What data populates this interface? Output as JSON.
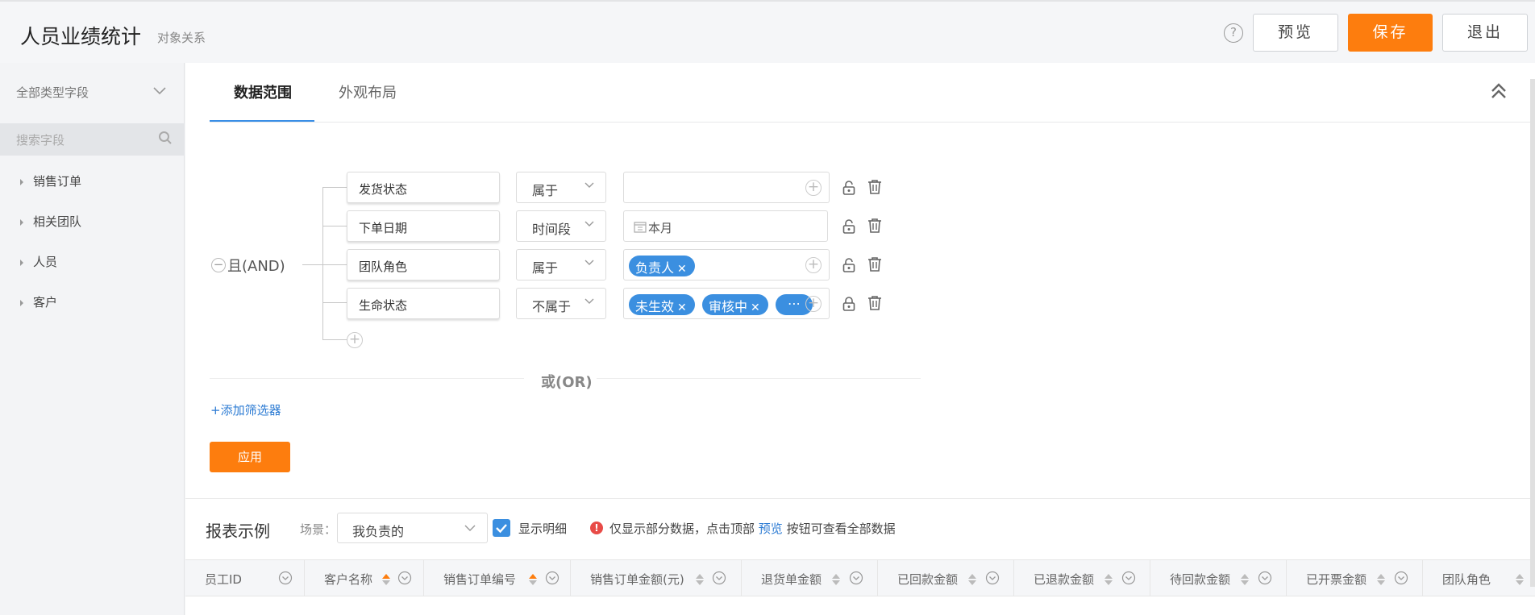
{
  "header": {
    "title": "人员业绩统计",
    "subtitle": "对象关系",
    "help": "?",
    "preview_label": "预览",
    "save_label": "保存",
    "exit_label": "退出"
  },
  "sidebar": {
    "type_filter": "全部类型字段",
    "search_placeholder": "搜索字段",
    "items": [
      {
        "label": "销售订单"
      },
      {
        "label": "相关团队"
      },
      {
        "label": "人员"
      },
      {
        "label": "客户"
      }
    ]
  },
  "tabs": [
    {
      "label": "数据范围",
      "active": true
    },
    {
      "label": "外观布局",
      "active": false
    }
  ],
  "filter": {
    "group_label": "且(AND)",
    "rows": [
      {
        "field": "发货状态",
        "operator": "属于",
        "value": ""
      },
      {
        "field": "下单日期",
        "operator": "时间段",
        "value": "本月"
      },
      {
        "field": "团队角色",
        "operator": "属于",
        "tags": [
          "负责人"
        ]
      },
      {
        "field": "生命状态",
        "operator": "不属于",
        "tags": [
          "未生效",
          "审核中"
        ],
        "more": "⋯"
      }
    ],
    "or_label": "或(OR)",
    "add_filter_label": "+添加筛选器",
    "apply_label": "应用"
  },
  "report": {
    "title": "报表示例",
    "scene_label": "场景：",
    "scene_value": "我负责的",
    "show_detail_label": "显示明细",
    "show_detail_checked": true,
    "notice_prefix": "仅显示部分数据，点击顶部",
    "notice_link": "预览",
    "notice_suffix": "按钮可查看全部数据",
    "columns": [
      {
        "label": "员工ID",
        "sort": "none"
      },
      {
        "label": "客户名称",
        "sort": "asc"
      },
      {
        "label": "销售订单编号",
        "sort": "asc"
      },
      {
        "label": "销售订单金额(元)",
        "sort": "none"
      },
      {
        "label": "退货单金额",
        "sort": "none"
      },
      {
        "label": "已回款金额",
        "sort": "none"
      },
      {
        "label": "已退款金额",
        "sort": "none"
      },
      {
        "label": "待回款金额",
        "sort": "none"
      },
      {
        "label": "已开票金额",
        "sort": "none"
      },
      {
        "label": "团队角色",
        "sort": "none"
      }
    ]
  },
  "colors": {
    "accent_orange": "#fd7d0e",
    "accent_blue": "#3b8fe0",
    "link_blue": "#2c7bd3",
    "warn_red": "#e84b47"
  }
}
